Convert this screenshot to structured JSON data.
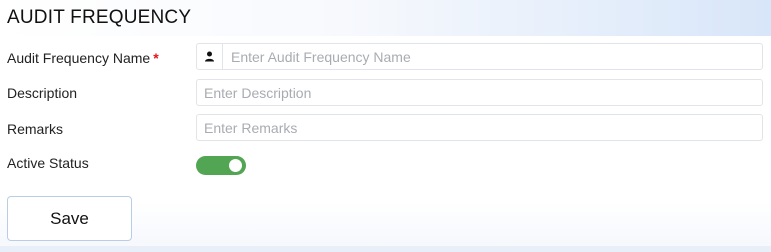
{
  "form": {
    "title": "AUDIT FREQUENCY",
    "fields": {
      "name": {
        "label": "Audit Frequency Name",
        "required_marker": "*",
        "placeholder": "Enter Audit Frequency Name",
        "value": "",
        "icon": "user-icon"
      },
      "description": {
        "label": "Description",
        "placeholder": "Enter Description",
        "value": ""
      },
      "remarks": {
        "label": "Remarks",
        "placeholder": "Enter Remarks",
        "value": ""
      },
      "active_status": {
        "label": "Active Status",
        "on": true
      }
    },
    "save_label": "Save"
  },
  "colors": {
    "toggle_on": "#52a552",
    "required": "#e0161b",
    "header_gradient_end": "#d8e6f9",
    "button_border": "#b9cde4"
  }
}
